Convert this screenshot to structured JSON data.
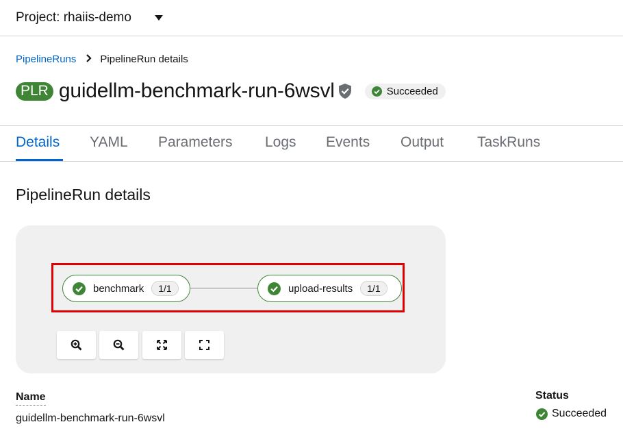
{
  "project": {
    "label": "Project: rhaiis-demo"
  },
  "breadcrumb": {
    "parent": "PipelineRuns",
    "current": "PipelineRun details"
  },
  "header": {
    "badge": "PLR",
    "title": "guidellm-benchmark-run-6wsvl",
    "status": "Succeeded"
  },
  "tabs": [
    {
      "label": "Details",
      "active": true
    },
    {
      "label": "YAML"
    },
    {
      "label": "Parameters"
    },
    {
      "label": "Logs"
    },
    {
      "label": "Events"
    },
    {
      "label": "Output"
    },
    {
      "label": "TaskRuns"
    }
  ],
  "section": {
    "title": "PipelineRun details"
  },
  "graph": {
    "tasks": [
      {
        "name": "benchmark",
        "count": "1/1"
      },
      {
        "name": "upload-results",
        "count": "1/1"
      }
    ],
    "controls": [
      "zoom-in-icon",
      "zoom-out-icon",
      "fit-to-screen-icon",
      "reset-view-icon"
    ]
  },
  "details": {
    "name_label": "Name",
    "name_value": "guidellm-benchmark-run-6wsvl",
    "status_label": "Status",
    "status_value": "Succeeded"
  },
  "colors": {
    "success": "#3e8635",
    "link": "#0066cc",
    "highlight": "#e00000",
    "panel": "#f0f0f0"
  }
}
